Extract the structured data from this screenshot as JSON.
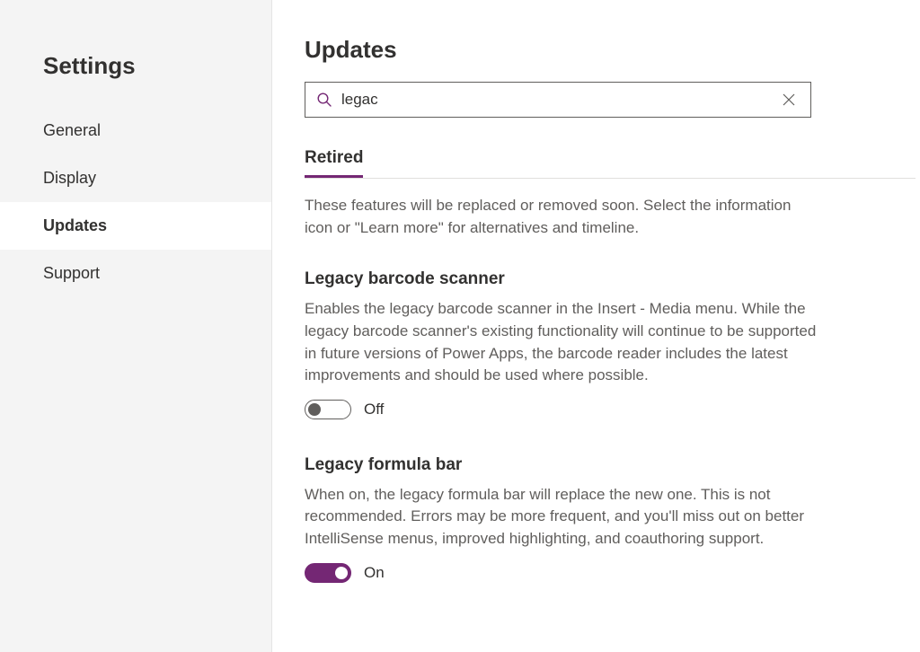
{
  "sidebar": {
    "title": "Settings",
    "items": [
      {
        "label": "General",
        "active": false
      },
      {
        "label": "Display",
        "active": false
      },
      {
        "label": "Updates",
        "active": true
      },
      {
        "label": "Support",
        "active": false
      }
    ]
  },
  "page": {
    "title": "Updates"
  },
  "search": {
    "value": "legac"
  },
  "tabs": {
    "retired": "Retired"
  },
  "section": {
    "description": "These features will be replaced or removed soon. Select the information icon or \"Learn more\" for alternatives and timeline."
  },
  "features": [
    {
      "title": "Legacy barcode scanner",
      "description": "Enables the legacy barcode scanner in the Insert - Media menu. While the legacy barcode scanner's existing functionality will continue to be supported in future versions of Power Apps, the barcode reader includes the latest improvements and should be used where possible.",
      "state": "off",
      "state_label": "Off"
    },
    {
      "title": "Legacy formula bar",
      "description": "When on, the legacy formula bar will replace the new one. This is not recommended. Errors may be more frequent, and you'll miss out on better IntelliSense menus, improved highlighting, and coauthoring support.",
      "state": "on",
      "state_label": "On"
    }
  ],
  "colors": {
    "accent": "#742774"
  }
}
